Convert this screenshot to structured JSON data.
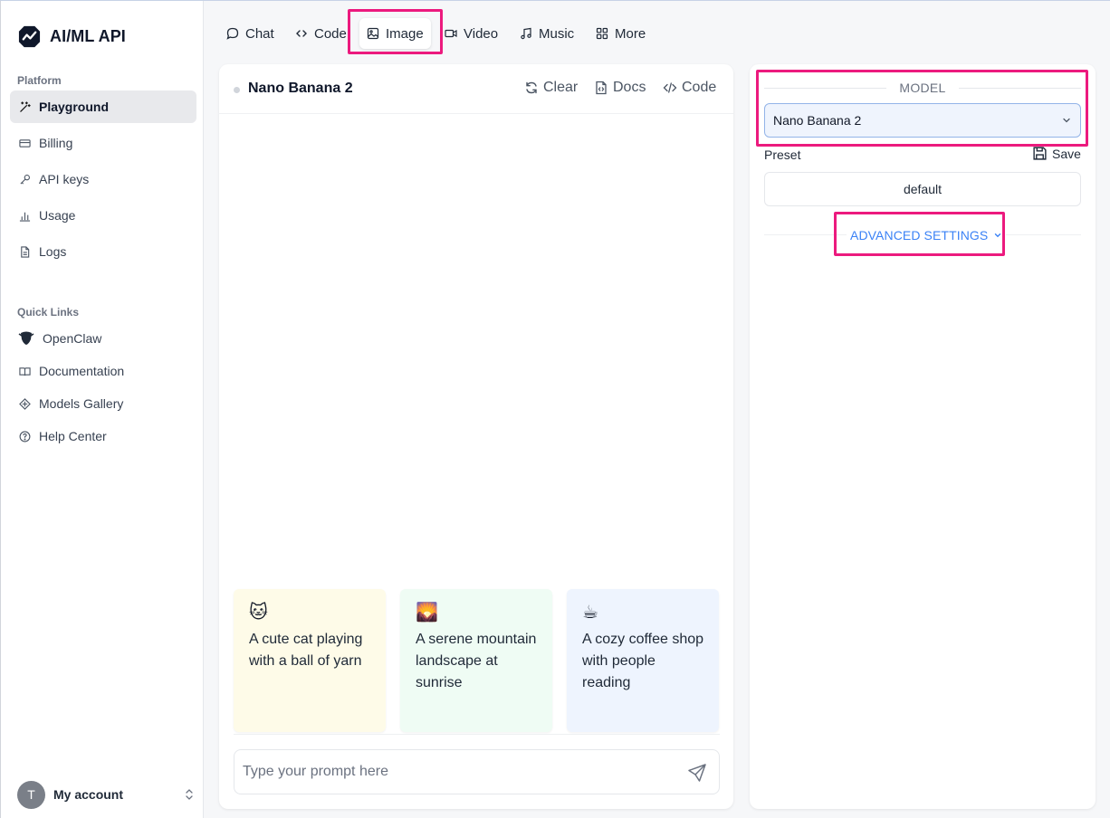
{
  "brand": {
    "name": "AI/ML API"
  },
  "sidebar": {
    "platform_label": "Platform",
    "items": [
      {
        "label": "Playground",
        "icon": "wand-icon",
        "active": true
      },
      {
        "label": "Billing",
        "icon": "credit-card-icon"
      },
      {
        "label": "API keys",
        "icon": "key-icon"
      },
      {
        "label": "Usage",
        "icon": "bar-chart-icon"
      },
      {
        "label": "Logs",
        "icon": "file-icon"
      }
    ],
    "quick_links_label": "Quick Links",
    "quick_links": [
      {
        "label": "OpenClaw",
        "icon": "openclaw-icon"
      },
      {
        "label": "Documentation",
        "icon": "book-icon"
      },
      {
        "label": "Models Gallery",
        "icon": "models-icon"
      },
      {
        "label": "Help Center",
        "icon": "help-icon"
      }
    ],
    "account": {
      "avatar_letter": "T",
      "label": "My account"
    }
  },
  "tabs": [
    {
      "label": "Chat",
      "icon": "chat-bubble-icon"
    },
    {
      "label": "Code",
      "icon": "code-icon"
    },
    {
      "label": "Image",
      "icon": "image-icon",
      "active": true
    },
    {
      "label": "Video",
      "icon": "video-icon"
    },
    {
      "label": "Music",
      "icon": "music-note-icon"
    },
    {
      "label": "More",
      "icon": "grid-icon"
    }
  ],
  "main": {
    "model_title": "Nano Banana 2",
    "actions": {
      "clear": "Clear",
      "docs": "Docs",
      "code": "Code"
    },
    "suggestions": [
      {
        "emoji": "🐱",
        "text": "A cute cat playing with a ball of yarn",
        "bg": "#fefbe8"
      },
      {
        "emoji": "🌄",
        "text": "A serene mountain landscape at sunrise",
        "bg": "#effcf4"
      },
      {
        "emoji": "☕",
        "text": "A cozy coffee shop with people reading",
        "bg": "#eef4fe"
      }
    ],
    "prompt_placeholder": "Type your prompt here"
  },
  "settings": {
    "model_label": "MODEL",
    "model_value": "Nano Banana 2",
    "preset_label": "Preset",
    "save_label": "Save",
    "preset_value": "default",
    "advanced_label": "ADVANCED SETTINGS"
  },
  "colors": {
    "highlight": "#ec1a7e",
    "accent": "#3b82f6"
  }
}
